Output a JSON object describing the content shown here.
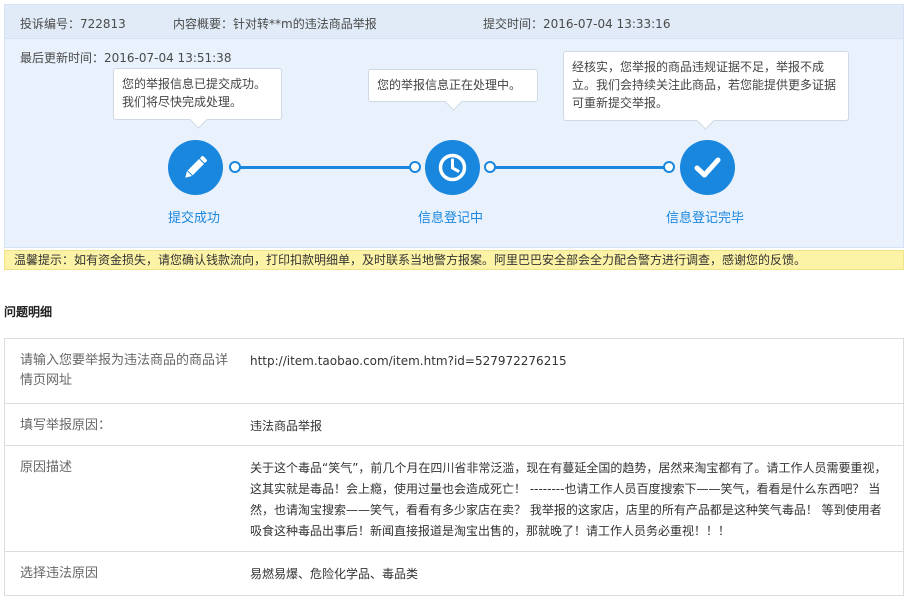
{
  "header": {
    "complaint_id": "投诉编号：722813",
    "summary": "内容概要：针对转**m的违法商品举报",
    "submit_time": "提交时间：2016-07-04 13:33:16"
  },
  "updated": "最后更新时间：2016-07-04 13:51:38",
  "steps": [
    {
      "label": "提交成功",
      "message": "您的举报信息已提交成功。我们将尽快完成处理。",
      "icon": "pencil-icon"
    },
    {
      "label": "信息登记中",
      "message": "您的举报信息正在处理中。",
      "icon": "clock-icon"
    },
    {
      "label": "信息登记完毕",
      "message": "经核实，您举报的商品违规证据不足，举报不成立。我们会持续关注此商品，若您能提供更多证据可重新提交举报。",
      "icon": "check-icon"
    }
  ],
  "colors": {
    "accent": "#1a87de",
    "panel_bg": "#e8f1fc",
    "tip_bg": "#fcf3a6"
  },
  "tip": "温馨提示：如有资金损失，请您确认钱款流向，打印扣款明细单，及时联系当地警方报案。阿里巴巴安全部会全力配合警方进行调查，感谢您的反馈。",
  "details": {
    "title": "问题明细",
    "rows": [
      {
        "label": "请输入您要举报为违法商品的商品详情页网址",
        "value": "http://item.taobao.com/item.htm?id=527972276215"
      },
      {
        "label": "填写举报原因：",
        "value": "违法商品举报"
      },
      {
        "label": "原因描述",
        "value": "关于这个毒品“笑气”，前几个月在四川省非常泛滥，现在有蔓延全国的趋势，居然来淘宝都有了。请工作人员需要重视，这其实就是毒品！会上瘾，使用过量也会造成死亡！ --------也请工作人员百度搜索下——笑气，看看是什么东西吧？ 当然，也请淘宝搜索——笑气，看看有多少家店在卖？ 我举报的这家店，店里的所有产品都是这种笑气毒品！ 等到使用者吸食这种毒品出事后！新闻直接报道是淘宝出售的，那就晚了！请工作人员务必重视！！！"
      },
      {
        "label": "选择违法原因",
        "value": "易燃易爆、危险化学品、毒品类"
      }
    ]
  }
}
